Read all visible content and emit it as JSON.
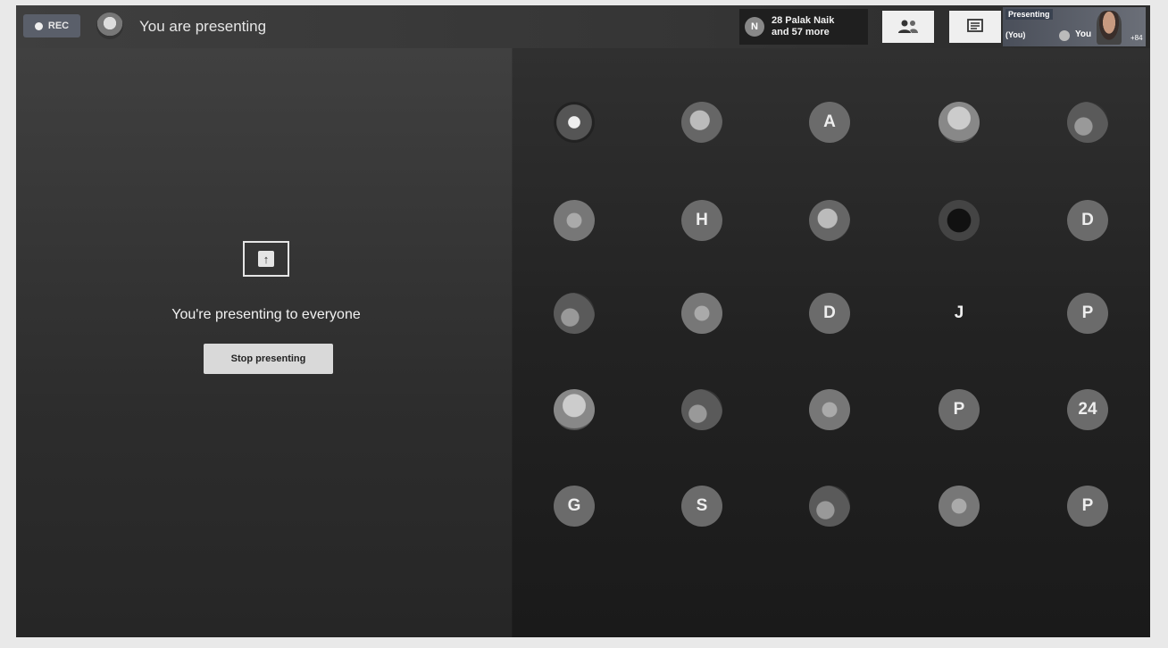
{
  "topbar": {
    "rec_label": "REC",
    "presenting_label": "You are presenting",
    "participants_chip": {
      "initial": "N",
      "line1": "28 Palak Naik",
      "line2": "and 57 more"
    },
    "self_tile": {
      "top_label": "Presenting",
      "bottom_label": "(You)",
      "you_label": "You",
      "more": "+84"
    }
  },
  "presentation": {
    "message": "You're presenting to everyone",
    "stop_button": "Stop presenting"
  },
  "participants": [
    {
      "row": 0,
      "col": 0,
      "kind": "photo",
      "label": ""
    },
    {
      "row": 0,
      "col": 1,
      "kind": "photo",
      "label": ""
    },
    {
      "row": 0,
      "col": 2,
      "kind": "letter",
      "label": "A"
    },
    {
      "row": 0,
      "col": 3,
      "kind": "photo",
      "label": ""
    },
    {
      "row": 0,
      "col": 4,
      "kind": "photo",
      "label": ""
    },
    {
      "row": 1,
      "col": 0,
      "kind": "photo",
      "label": ""
    },
    {
      "row": 1,
      "col": 1,
      "kind": "letter",
      "label": "H"
    },
    {
      "row": 1,
      "col": 2,
      "kind": "photo",
      "label": ""
    },
    {
      "row": 1,
      "col": 3,
      "kind": "photo",
      "label": ""
    },
    {
      "row": 1,
      "col": 4,
      "kind": "letter",
      "label": "D"
    },
    {
      "row": 2,
      "col": 0,
      "kind": "photo",
      "label": ""
    },
    {
      "row": 2,
      "col": 1,
      "kind": "photo",
      "label": ""
    },
    {
      "row": 2,
      "col": 2,
      "kind": "letter",
      "label": "D"
    },
    {
      "row": 2,
      "col": 3,
      "kind": "letter-dark",
      "label": "J"
    },
    {
      "row": 2,
      "col": 4,
      "kind": "letter",
      "label": "P"
    },
    {
      "row": 3,
      "col": 0,
      "kind": "photo",
      "label": ""
    },
    {
      "row": 3,
      "col": 1,
      "kind": "photo",
      "label": ""
    },
    {
      "row": 3,
      "col": 2,
      "kind": "photo",
      "label": ""
    },
    {
      "row": 3,
      "col": 3,
      "kind": "letter",
      "label": "P"
    },
    {
      "row": 3,
      "col": 4,
      "kind": "letter",
      "label": "24"
    },
    {
      "row": 4,
      "col": 0,
      "kind": "letter",
      "label": "G"
    },
    {
      "row": 4,
      "col": 1,
      "kind": "letter",
      "label": "S"
    },
    {
      "row": 4,
      "col": 2,
      "kind": "photo",
      "label": ""
    },
    {
      "row": 4,
      "col": 3,
      "kind": "photo",
      "label": ""
    },
    {
      "row": 4,
      "col": 4,
      "kind": "letter",
      "label": "P"
    }
  ]
}
